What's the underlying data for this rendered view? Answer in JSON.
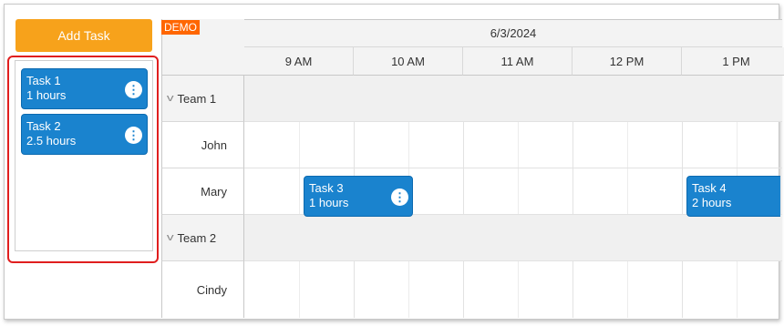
{
  "sidebar": {
    "add_button_label": "Add Task",
    "queue_tasks": [
      {
        "title": "Task 1",
        "duration": "1 hours"
      },
      {
        "title": "Task 2",
        "duration": "2.5 hours"
      }
    ]
  },
  "badge": "DEMO",
  "calendar": {
    "date": "6/3/2024",
    "hours": [
      "9 AM",
      "10 AM",
      "11 AM",
      "12 PM",
      "1 PM"
    ],
    "rows": [
      {
        "type": "group",
        "label": "Team 1"
      },
      {
        "type": "resource",
        "label": "John"
      },
      {
        "type": "resource",
        "label": "Mary"
      },
      {
        "type": "group",
        "label": "Team 2"
      },
      {
        "type": "resource",
        "label": "Cindy"
      }
    ],
    "events": [
      {
        "title": "Task 3",
        "duration": "1 hours"
      },
      {
        "title": "Task 4",
        "duration": "2 hours"
      }
    ]
  },
  "colors": {
    "accent": "#f7a21b",
    "event": "#1a83ce",
    "highlight": "#e01e1e",
    "badge": "#ff6600"
  },
  "icons": {
    "task_menu": "kebab-menu-icon",
    "collapse": "chevron-down-icon"
  }
}
